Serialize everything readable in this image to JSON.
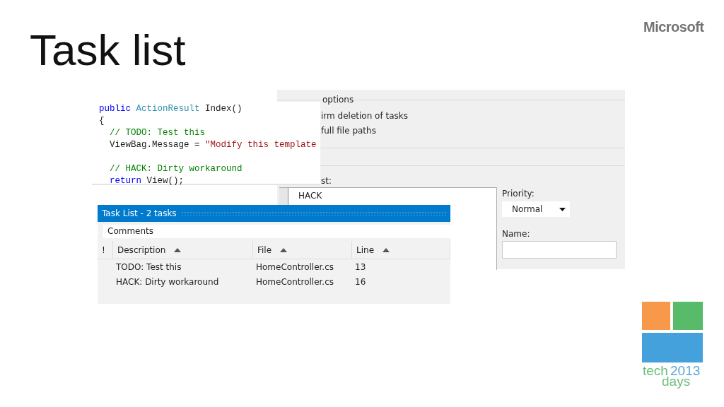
{
  "slide": {
    "title": "Task list",
    "brand": "Microsoft",
    "event_logo": {
      "word_1": "tech",
      "year": "2013",
      "word_2": "days"
    }
  },
  "options_dialog": {
    "group_label": "options",
    "options": [
      {
        "label": "irm deletion of tasks"
      },
      {
        "label": "full file paths"
      }
    ],
    "token_list_label": "st:",
    "token_field": {
      "value": "HACK"
    },
    "priority": {
      "label": "Priority:",
      "value": "Normal"
    },
    "name": {
      "label": "Name:"
    }
  },
  "code_editor": {
    "lines": [
      {
        "indented": false,
        "spaced": false,
        "tokens": [
          {
            "kind": "keyword",
            "text": "public"
          },
          {
            "kind": "type",
            "text": "ActionResult"
          },
          {
            "kind": "plain",
            "text": "Index()"
          }
        ]
      },
      {
        "indented": false,
        "spaced": false,
        "tokens": [
          {
            "kind": "plain",
            "text": "{"
          }
        ]
      },
      {
        "indented": true,
        "spaced": false,
        "tokens": [
          {
            "kind": "comment",
            "text": "// TODO: Test this"
          }
        ]
      },
      {
        "indented": true,
        "spaced": false,
        "tokens": [
          {
            "kind": "plain",
            "text": "ViewBag.Message ="
          },
          {
            "kind": "string",
            "text": "\"Modify this template"
          }
        ]
      },
      {
        "indented": true,
        "spaced": true,
        "tokens": [
          {
            "kind": "comment",
            "text": "// HACK: Dirty workaround"
          }
        ]
      },
      {
        "indented": true,
        "spaced": false,
        "tokens": [
          {
            "kind": "keyword",
            "text": "return"
          },
          {
            "kind": "plain",
            "text": "View();"
          }
        ]
      }
    ]
  },
  "task_list": {
    "title": "Task List - 2 tasks",
    "filter": {
      "value": "Comments"
    },
    "columns": [
      {
        "label": "!",
        "sorted": false
      },
      {
        "label": "Description",
        "sorted": true
      },
      {
        "label": "File",
        "sorted": true
      },
      {
        "label": "Line",
        "sorted": true
      }
    ],
    "rows": [
      {
        "cells": [
          "",
          "TODO: Test this",
          "HomeController.cs",
          "13"
        ]
      },
      {
        "cells": [
          "",
          "HACK: Dirty workaround",
          "HomeController.cs",
          "16"
        ]
      }
    ]
  }
}
